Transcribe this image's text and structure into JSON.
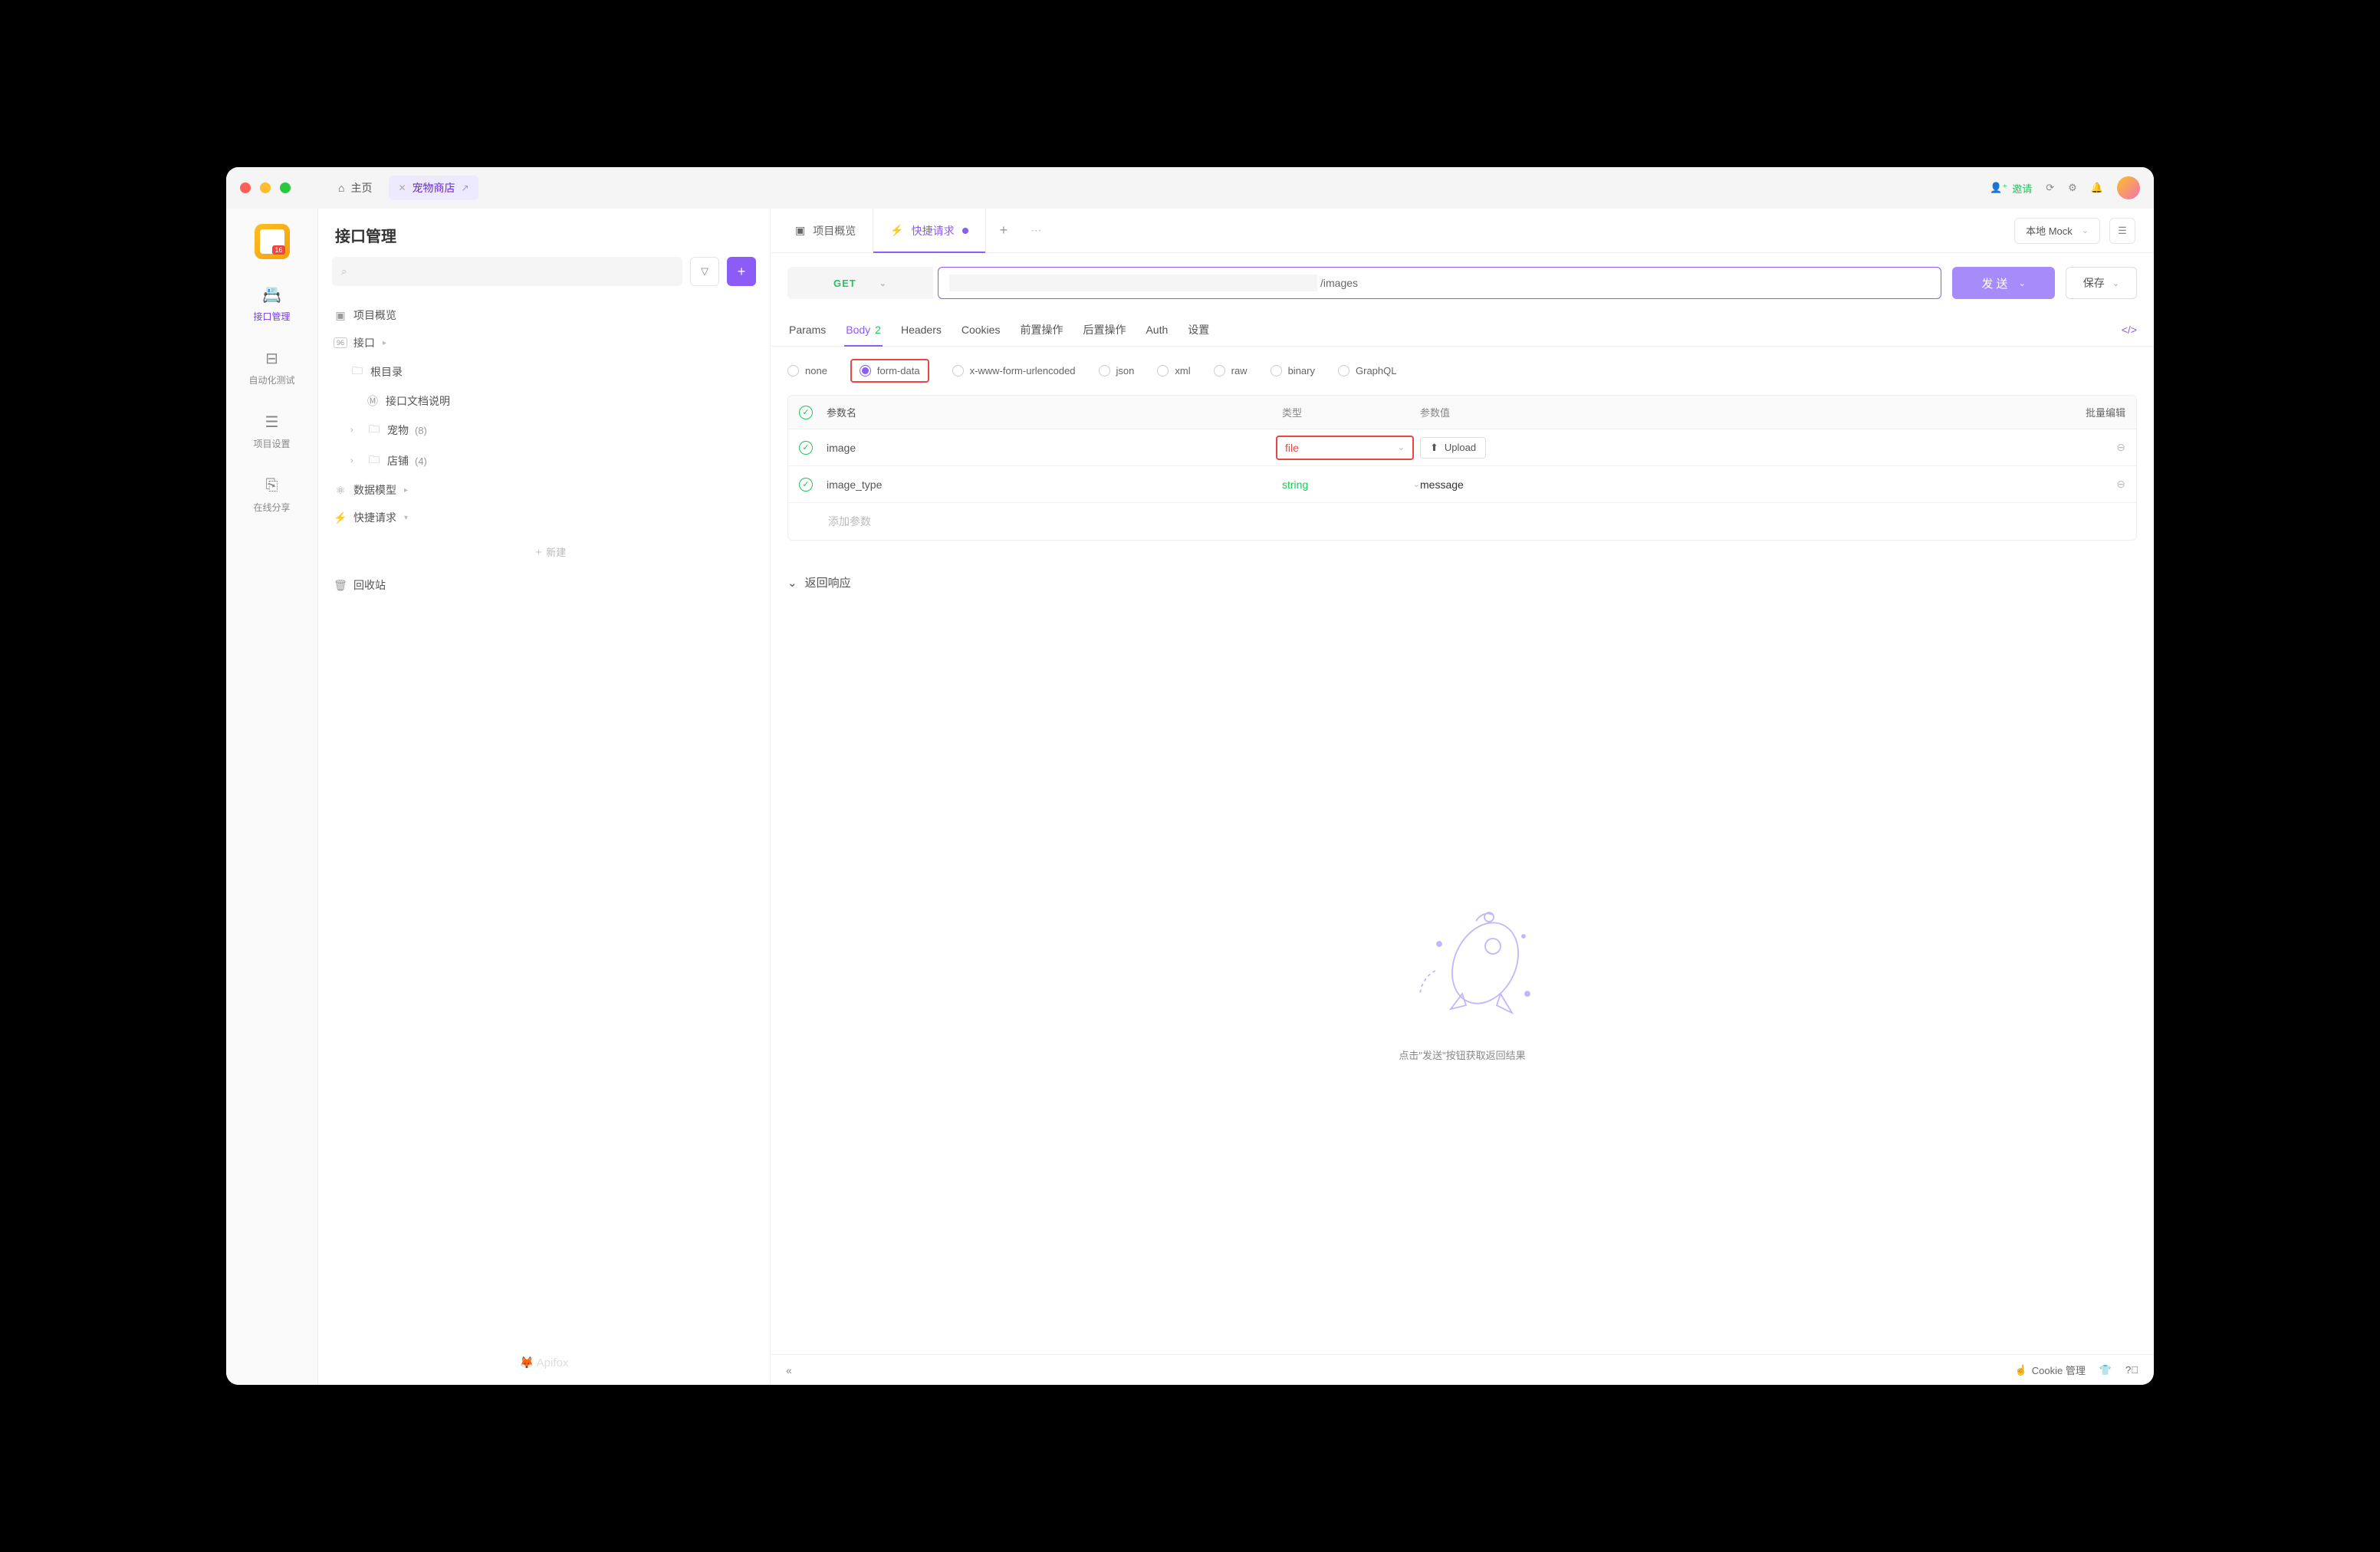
{
  "titlebar": {
    "home_label": "主页",
    "project_label": "宠物商店",
    "invite_label": "邀请"
  },
  "rail": {
    "items": [
      {
        "label": "接口管理"
      },
      {
        "label": "自动化测试"
      },
      {
        "label": "项目设置"
      },
      {
        "label": "在线分享"
      }
    ]
  },
  "sidebar": {
    "title": "接口管理",
    "project_overview": "项目概览",
    "interface_label": "接口",
    "root_folder": "根目录",
    "doc_name": "接口文档说明",
    "folders": [
      {
        "name": "宠物",
        "count": "(8)"
      },
      {
        "name": "店铺",
        "count": "(4)"
      }
    ],
    "data_model": "数据模型",
    "quick_request": "快捷请求",
    "new_label": "新建",
    "recycle_bin": "回收站",
    "brand": "Apifox"
  },
  "ctabs": {
    "overview": "项目概览",
    "quick_request": "快捷请求",
    "env": "本地 Mock"
  },
  "urlbar": {
    "method": "GET",
    "url_suffix": "/images",
    "send": "发 送",
    "save": "保存"
  },
  "ptabs": {
    "params": "Params",
    "body": "Body",
    "body_count": "2",
    "headers": "Headers",
    "cookies": "Cookies",
    "pre_action": "前置操作",
    "post_action": "后置操作",
    "auth": "Auth",
    "settings": "设置"
  },
  "body_types": {
    "none": "none",
    "form_data": "form-data",
    "urlencoded": "x-www-form-urlencoded",
    "json": "json",
    "xml": "xml",
    "raw": "raw",
    "binary": "binary",
    "graphql": "GraphQL"
  },
  "ptable": {
    "col_name": "参数名",
    "col_type": "类型",
    "col_value": "参数值",
    "batch_edit": "批量编辑",
    "add_param": "添加参数",
    "upload": "Upload",
    "rows": [
      {
        "name": "image",
        "type": "file",
        "value_kind": "upload"
      },
      {
        "name": "image_type",
        "type": "string",
        "value": "message"
      }
    ]
  },
  "response": {
    "header": "返回响应",
    "empty_msg": "点击\"发送\"按钮获取返回结果"
  },
  "statusbar": {
    "cookie_mgmt": "Cookie 管理"
  }
}
